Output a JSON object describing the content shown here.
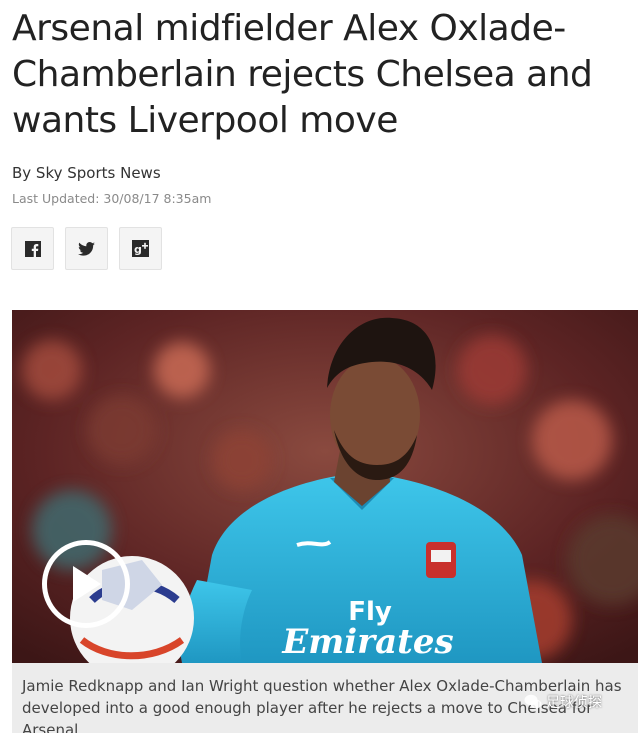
{
  "article": {
    "headline_lines": [
      "Arsenal midfielder Alex Oxlade-",
      "Chamberlain rejects Chelsea and",
      "wants Liverpool move"
    ],
    "byline": "By Sky Sports News",
    "last_updated": "Last Updated: 30/08/17 8:35am"
  },
  "share": {
    "facebook_icon": "facebook-icon",
    "twitter_icon": "twitter-icon",
    "googleplus_icon": "google-plus-icon"
  },
  "media": {
    "jersey_text_1": "Fly",
    "jersey_text_2": "Emirates",
    "caption": "Jamie Redknapp and Ian Wright question whether Alex Oxlade-Chamberlain has developed into a good enough player after he rejects a move to Chelsea for Arsenal"
  },
  "watermark": {
    "text": "足球侦探"
  },
  "colors": {
    "kit": "#2fb4da",
    "crowd": "#6a2b2b"
  }
}
